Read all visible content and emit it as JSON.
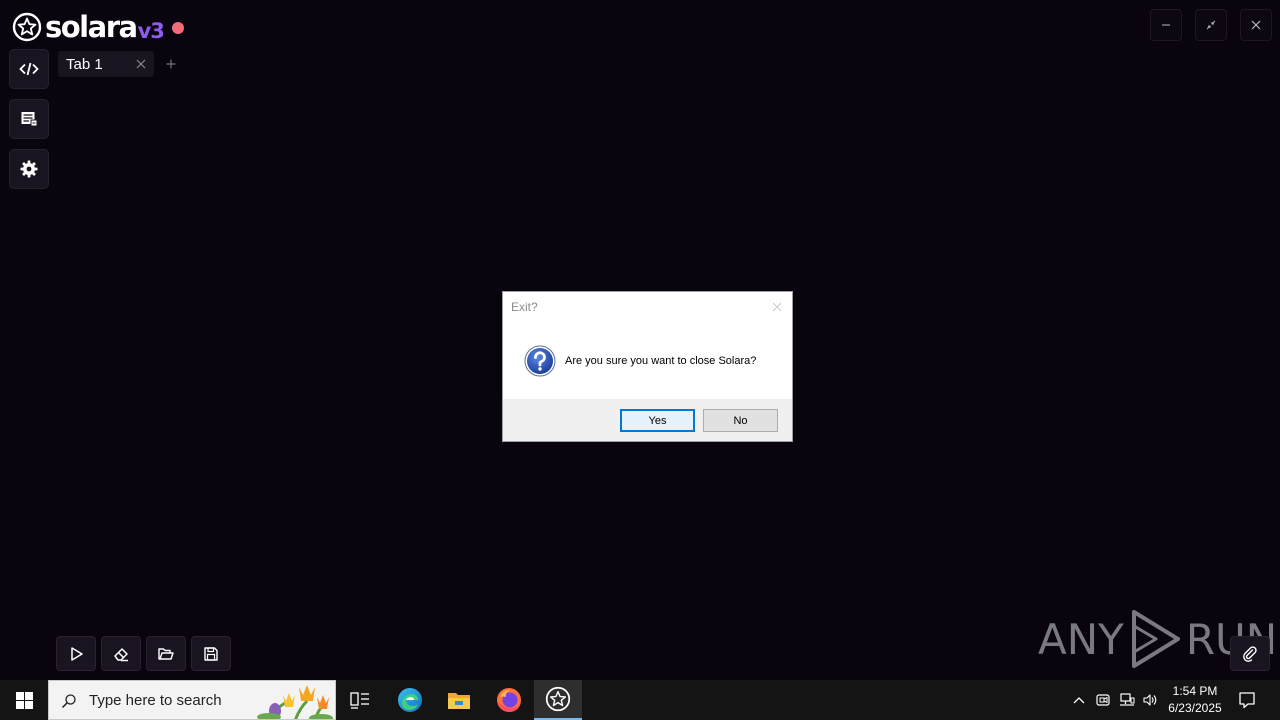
{
  "app": {
    "logo_word": "solara",
    "logo_version": "v3",
    "status_color": "#f26b7a",
    "accent_color": "#8f5cf0"
  },
  "sidebar": {
    "items": [
      {
        "icon": "code-icon"
      },
      {
        "icon": "script-list-icon"
      },
      {
        "icon": "gear-icon"
      }
    ]
  },
  "tabs": [
    {
      "label": "Tab 1",
      "active": true
    }
  ],
  "toolbar": {
    "tools": [
      "play-icon",
      "eraser-icon",
      "folder-open-icon",
      "save-icon"
    ]
  },
  "watermark": {
    "left": "ANY",
    "right": "RUN"
  },
  "dialog": {
    "title": "Exit?",
    "message": "Are you sure you want to close Solara?",
    "yes_label": "Yes",
    "no_label": "No"
  },
  "taskbar": {
    "search_placeholder": "Type here to search",
    "time": "1:54 PM",
    "date": "6/23/2025",
    "active_highlight": "#76b9ed"
  }
}
